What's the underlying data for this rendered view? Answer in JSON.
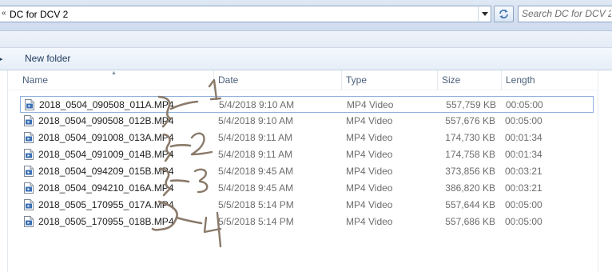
{
  "address_bar": {
    "separator": "«",
    "path": "DC for DCV 2",
    "dropdown_icon": "chevron-down-icon",
    "refresh_icon": "refresh-icon"
  },
  "search": {
    "placeholder": "Search DC for DCV 2"
  },
  "toolbar": {
    "new_folder_label": "New folder"
  },
  "columns": {
    "name": "Name",
    "date": "Date",
    "type": "Type",
    "size": "Size",
    "length": "Length"
  },
  "sort": {
    "column": "name",
    "direction": "ascending"
  },
  "files": [
    {
      "name": "2018_0504_090508_011A.MP4",
      "date": "5/4/2018 9:10 AM",
      "type": "MP4 Video",
      "size": "557,759 KB",
      "length": "00:05:00",
      "selected": true
    },
    {
      "name": "2018_0504_090508_012B.MP4",
      "date": "5/4/2018 9:10 AM",
      "type": "MP4 Video",
      "size": "557,676 KB",
      "length": "00:05:00"
    },
    {
      "name": "2018_0504_091008_013A.MP4",
      "date": "5/4/2018 9:11 AM",
      "type": "MP4 Video",
      "size": "174,730 KB",
      "length": "00:01:34"
    },
    {
      "name": "2018_0504_091009_014B.MP4",
      "date": "5/4/2018 9:11 AM",
      "type": "MP4 Video",
      "size": "174,758 KB",
      "length": "00:01:34"
    },
    {
      "name": "2018_0504_094209_015B.MP4",
      "date": "5/4/2018 9:45 AM",
      "type": "MP4 Video",
      "size": "373,856 KB",
      "length": "00:03:21"
    },
    {
      "name": "2018_0504_094210_016A.MP4",
      "date": "5/4/2018 9:45 AM",
      "type": "MP4 Video",
      "size": "386,820 KB",
      "length": "00:03:21"
    },
    {
      "name": "2018_0505_170955_017A.MP4",
      "date": "5/5/2018 5:14 PM",
      "type": "MP4 Video",
      "size": "557,644 KB",
      "length": "00:05:00"
    },
    {
      "name": "2018_0505_170955_018B.MP4",
      "date": "5/5/2018 5:14 PM",
      "type": "MP4 Video",
      "size": "557,686 KB",
      "length": "00:05:00"
    }
  ],
  "annotations": {
    "color": "#8a7a6a",
    "labels": [
      "1",
      "2",
      "3",
      "4"
    ]
  },
  "colors": {
    "toolbar_text": "#1e395b",
    "header_text": "#4c607a",
    "selection_border": "#8fb1dc"
  }
}
